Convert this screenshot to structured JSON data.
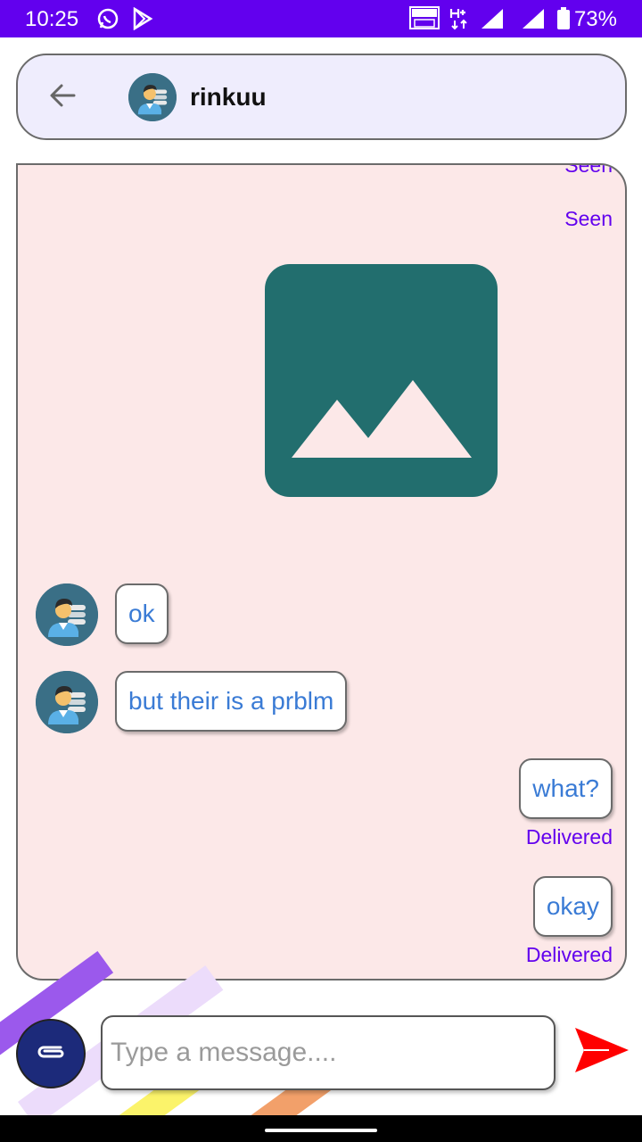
{
  "status_bar": {
    "time": "10:25",
    "battery": "73%",
    "icons": [
      "whatsapp-icon",
      "play-store-icon",
      "volte-icon",
      "network-h-plus-icon",
      "signal-icon",
      "signal-icon",
      "battery-icon"
    ]
  },
  "header": {
    "back_icon": "arrow-left-icon",
    "contact_name": "rinkuu"
  },
  "chat": {
    "top_status_clipped": "Seen",
    "image_status": "Seen",
    "image_icon": "image-placeholder-icon",
    "messages": [
      {
        "direction": "incoming",
        "text": "ok"
      },
      {
        "direction": "incoming",
        "text": "but their is a prblm"
      },
      {
        "direction": "outgoing",
        "text": "what?",
        "status": "Delivered"
      },
      {
        "direction": "outgoing",
        "text": "okay",
        "status": "Delivered"
      }
    ]
  },
  "composer": {
    "attach_icon": "paperclip-icon",
    "placeholder": "Type a message....",
    "value": "",
    "send_icon": "send-icon"
  },
  "colors": {
    "status_bar": "#6200EE",
    "header_bg": "#EFEDFD",
    "chat_bg": "#FCE8E8",
    "status_text": "#6200EE",
    "message_text": "#3a7bd5",
    "image_tile": "#226E6E",
    "attach_button": "#1c2a7a",
    "send_arrow": "#ff0000"
  }
}
